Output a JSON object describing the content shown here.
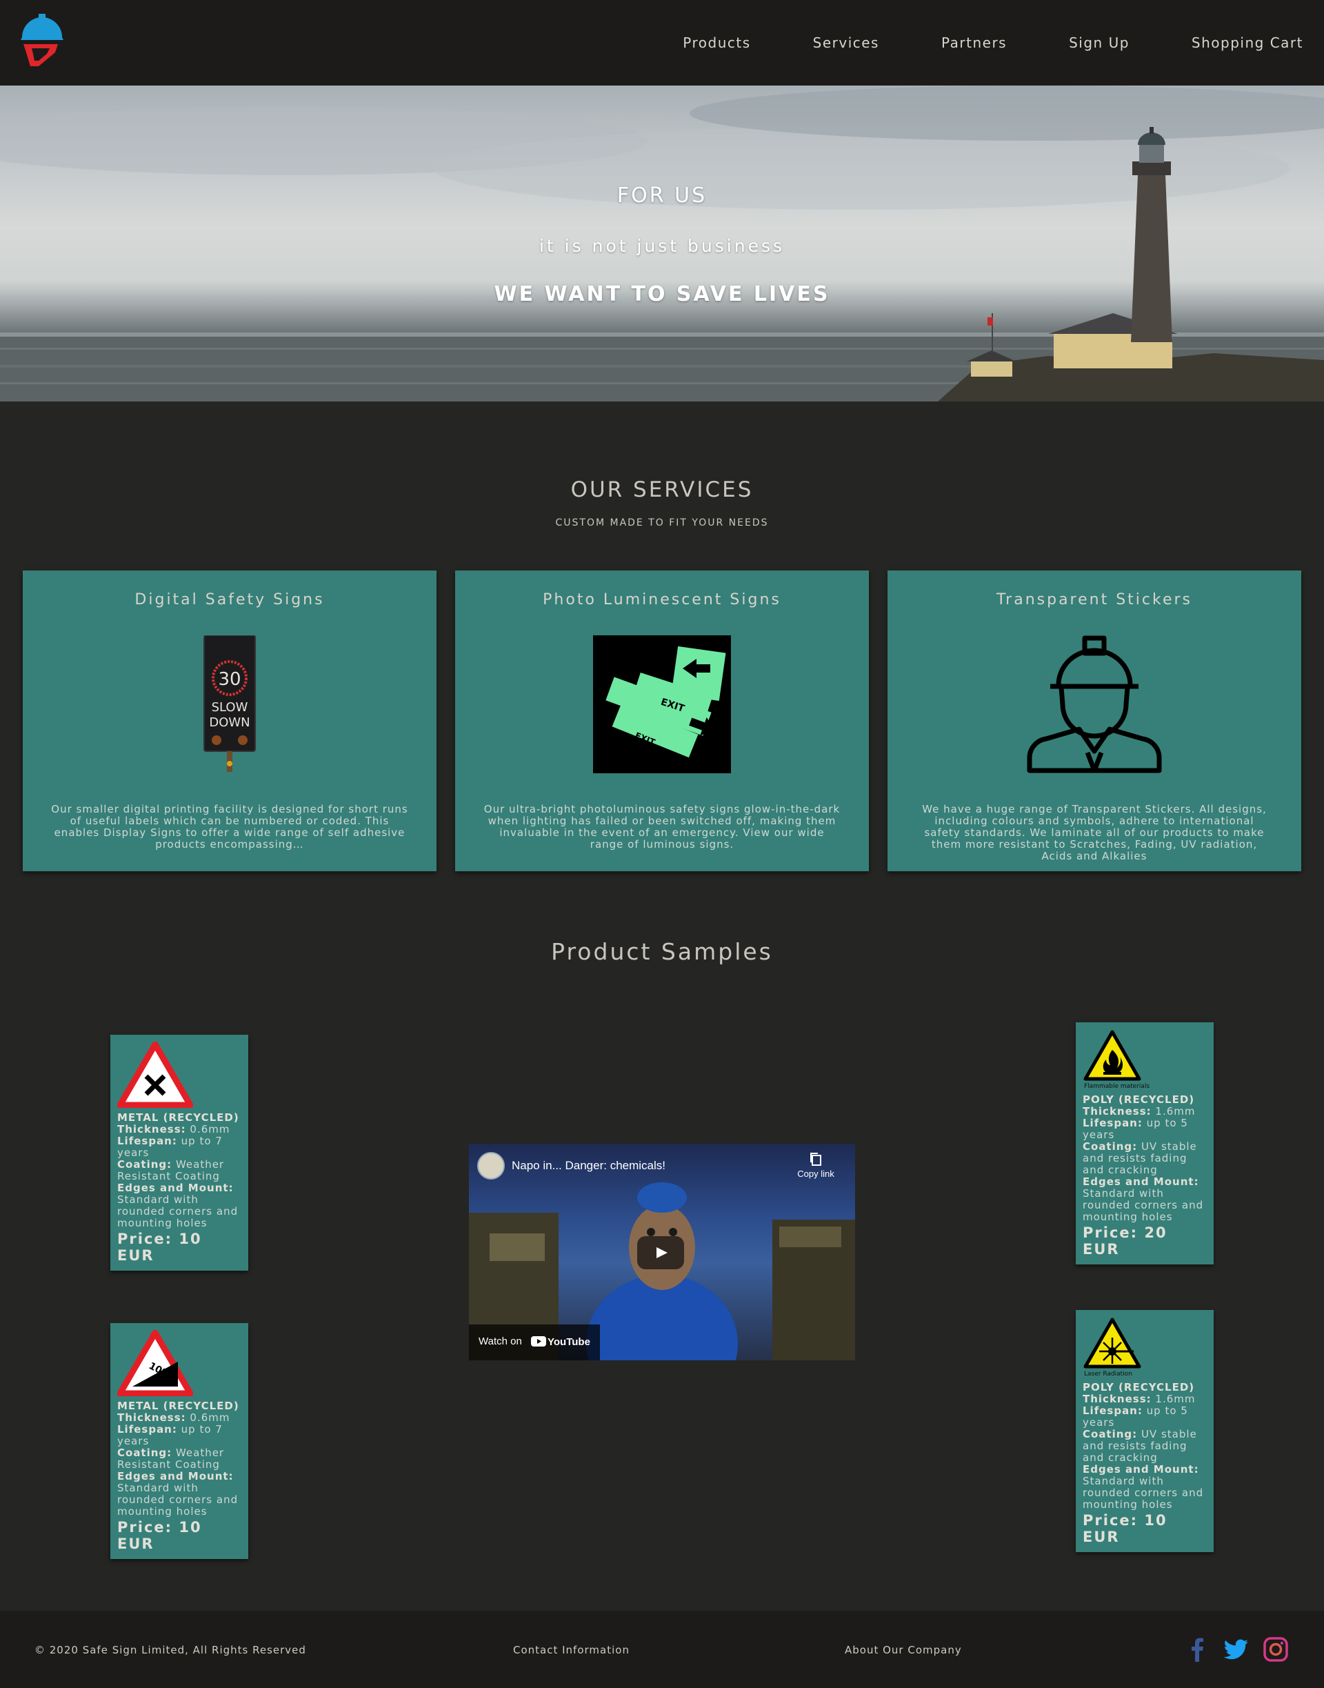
{
  "nav": {
    "logo": "safe-sign-helmet-logo",
    "links": [
      "Products",
      "Services",
      "Partners",
      "Sign Up",
      "Shopping Cart"
    ]
  },
  "hero": {
    "line1": "FOR US",
    "line2": "it is not just business",
    "line3": "WE WANT TO SAVE LIVES"
  },
  "services": {
    "title": "OUR SERVICES",
    "subtitle": "CUSTOM MADE TO FIT YOUR NEEDS",
    "cards": [
      {
        "title": "Digital Safety Signs",
        "image_text": [
          "30",
          "SLOW",
          "DOWN"
        ],
        "description": "Our smaller digital printing facility is designed for short runs of useful labels which can be numbered or coded. This enables Display Signs to offer a wide range of self adhesive products encompassing…"
      },
      {
        "title": "Photo Luminescent Signs",
        "image_text": [
          "EXIT",
          "EXIT"
        ],
        "description": "Our ultra-bright photoluminous safety signs glow-in-the-dark when lighting has failed or been switched off, making them invaluable in the event of an emergency. View our wide range of luminous signs."
      },
      {
        "title": "Transparent Stickers",
        "description": "We have a huge range of Transparent Stickers. All designs, including colours and symbols, adhere to international safety standards. We laminate all of our products to make them more resistant to Scratches, Fading, UV radiation, Acids and Alkalies"
      }
    ]
  },
  "samples": {
    "title": "Product Samples",
    "labels": {
      "thickness": "Thickness:",
      "lifespan": "Lifespan:",
      "coating": "Coating:",
      "edges": "Edges and Mount:"
    },
    "products": [
      {
        "type": "METAL (RECYCLED)",
        "thickness": " 0.6mm",
        "lifespan": " up to 7 years",
        "coating": " Weather Resistant Coating",
        "edges": " Standard with rounded corners and mounting holes",
        "price": "Price: 10 EUR"
      },
      {
        "type": "METAL (RECYCLED)",
        "sign_text": "10%",
        "thickness": " 0.6mm",
        "lifespan": " up to 7 years",
        "coating": " Weather Resistant Coating",
        "edges": " Standard with rounded corners and mounting holes",
        "price": "Price: 10 EUR"
      },
      {
        "caption": "Flammable materials",
        "type": "POLY (RECYCLED)",
        "thickness": " 1.6mm",
        "lifespan": " up to 5 years",
        "coating": " UV stable and resists fading and cracking",
        "edges": " Standard with rounded corners and mounting holes",
        "price": "Price: 20 EUR"
      },
      {
        "caption": "Laser Radiation",
        "type": "POLY (RECYCLED)",
        "thickness": " 1.6mm",
        "lifespan": " up to 5 years",
        "coating": " UV stable and resists fading and cracking",
        "edges": " Standard with rounded corners and mounting holes",
        "price": "Price: 10 EUR"
      }
    ]
  },
  "video": {
    "title": "Napo in... Danger: chemicals!",
    "copy_label": "Copy link",
    "watch_label": "Watch on",
    "youtube_label": "YouTube"
  },
  "footer": {
    "copyright": "© 2020 Safe Sign Limited, All Rights Reserved",
    "contact": "Contact Information",
    "about": "About Our Company",
    "social": [
      "facebook-icon",
      "twitter-icon",
      "instagram-icon"
    ]
  },
  "colors": {
    "nav_bg": "#1c1b19",
    "page_bg": "#252523",
    "card_bg": "#368079",
    "logo_blue": "#1e9ad6",
    "logo_red": "#e0262b",
    "facebook": "#3b5998",
    "twitter": "#1da1f2"
  }
}
